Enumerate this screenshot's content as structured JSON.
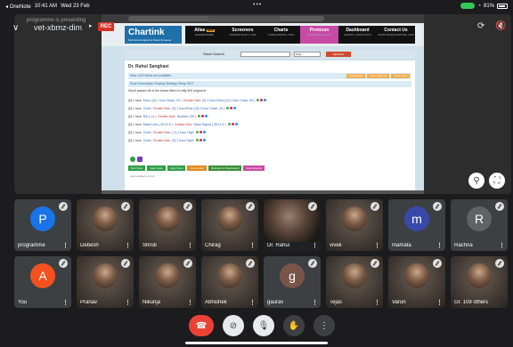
{
  "status_bar": {
    "app": "◂ OneNote",
    "time": "10:41 AM",
    "date": "Wed 23 Feb",
    "dots": "•••",
    "wifi": "wifi",
    "battery": "81%"
  },
  "header": {
    "meeting_code": "vet-xbmz-dim",
    "overlay_text": "programme is presenting",
    "rec_label": "REC",
    "chevron": "chevron-down-icon",
    "camera_switch": "camera-flip-icon",
    "sound": "speaker-off-icon"
  },
  "presentation": {
    "site": {
      "logo": "Chartink",
      "logo_sub": "Technical Analysis & Stock Screener",
      "nav": [
        {
          "label": "Atlas",
          "sub": "DASHBOARDS",
          "badge": "NEW",
          "active": false
        },
        {
          "label": "Screeners",
          "sub": "CREATE SCAN / LIVE",
          "badge": "",
          "active": false
        },
        {
          "label": "Charts",
          "sub": "CANDLESTICK / RSP",
          "badge": "",
          "active": false
        },
        {
          "label": "Premium",
          "sub": "REALTIME ALERTS",
          "badge": "",
          "active": true
        },
        {
          "label": "Dashboard",
          "sub": "ALERTS / WATCHLIST",
          "badge": "",
          "active": false
        },
        {
          "label": "Contact Us",
          "sub": "SUPPORT@CHARTINK.COM",
          "badge": "",
          "active": false
        }
      ],
      "search_label": "Stock Search",
      "search_select": "Daily",
      "search_button": "SEARCH",
      "author": "Dr. Rahul Sanghavi",
      "alert_text": "New LIVE Alerts are available",
      "alert_buttons": [
        "Create Alert",
        "Save Scanner",
        "Copy Scan"
      ],
      "desc_text": "Scan Description: Buying Strategy Setup BUY",
      "note_text": "Stock passes all of the below filters in nifty 500 segment:",
      "rows": [
        {
          "prefix": "[0] 1 hour",
          "a": "Ema ( [0] 1 hour Close, 20 )",
          "op": "Greater than",
          "b": "[0] 1 hour Ema ( [0] 1 hour Close, 50 )"
        },
        {
          "prefix": "[0] 1 hour",
          "a": "Close",
          "op": "Greater than",
          "b": "[0] 1 hour Ema ( [0] 1 hour Close, 20 )"
        },
        {
          "prefix": "[0] 1 hour",
          "a": "Rsi ( 14 )",
          "op": "Greater than",
          "b": "Number ( 50 )"
        },
        {
          "prefix": "[0] 1 hour",
          "a": "Macd Line ( 26,12,9 )",
          "op": "Greater than",
          "b": "Macd Signal ( 26,12,9 )"
        },
        {
          "prefix": "[0] 1 hour",
          "a": "Close",
          "op": "Greater than",
          "b": "[-1] 1 hour High"
        },
        {
          "prefix": "[0] 1 hour",
          "a": "Close",
          "op": "Greater than",
          "b": "[0] 1 hour Open"
        }
      ],
      "action_buttons": [
        {
          "label": "Run Scan",
          "color": "#2e9e46"
        },
        {
          "label": "Save Scan",
          "color": "#2e9e46"
        },
        {
          "label": "Copy Scan",
          "color": "#2e9e46"
        },
        {
          "label": "Create Alert",
          "color": "#e08a1e"
        },
        {
          "label": "Backtest on Dashboard",
          "color": "#3a8f3a"
        },
        {
          "label": "Scan Results",
          "color": "#c74aa6"
        }
      ],
      "footer_text": "Last updated on Feb"
    },
    "pin_icon": "pin-icon",
    "fullscreen_icon": "fullscreen-icon"
  },
  "participants": [
    {
      "name": "programme",
      "type": "letter",
      "letter": "P",
      "color": "#1a73e8"
    },
    {
      "name": "Debesh",
      "type": "photo"
    },
    {
      "name": "Shruti",
      "type": "photo"
    },
    {
      "name": "Chirag",
      "type": "photo"
    },
    {
      "name": "Dr. Rahul",
      "type": "presenter"
    },
    {
      "name": "vivek",
      "type": "photo"
    },
    {
      "name": "mamata",
      "type": "letter",
      "letter": "m",
      "color": "#3949ab"
    },
    {
      "name": "Rachna",
      "type": "letter",
      "letter": "R",
      "color": "#5f6368"
    },
    {
      "name": "You",
      "type": "letter",
      "letter": "A",
      "color": "#f4511e"
    },
    {
      "name": "Pranav",
      "type": "photo"
    },
    {
      "name": "Nikunja",
      "type": "photo"
    },
    {
      "name": "Abhishek",
      "type": "photo"
    },
    {
      "name": "gaurav",
      "type": "letter",
      "letter": "g",
      "color": "#795548"
    },
    {
      "name": "Tejas",
      "type": "photo"
    },
    {
      "name": "Varun",
      "type": "photo"
    },
    {
      "name": "Gr. 109 others",
      "type": "photo"
    }
  ],
  "controls": {
    "end_call": "phone-hangup-icon",
    "camera": "camera-off-icon",
    "mic": "mic-off-icon",
    "hand": "raise-hand-icon",
    "more": "more-vertical-icon",
    "end_glyph": "☎",
    "camera_glyph": "⊘",
    "mic_glyph": "🎙",
    "hand_glyph": "✋",
    "more_glyph": "⋮"
  },
  "colors": {
    "end_call": "#ea4335",
    "rec": "#d93025",
    "premium_nav": "#c74aa6"
  }
}
